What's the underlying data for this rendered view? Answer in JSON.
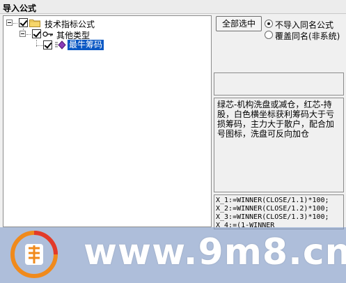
{
  "window": {
    "title": "导入公式"
  },
  "tree": {
    "root": {
      "label": "技术指标公式",
      "checked": true,
      "expanded": true
    },
    "group": {
      "label": "其他类型",
      "checked": true,
      "expanded": true
    },
    "item": {
      "label": "最牛筹码",
      "checked": true,
      "selected": true
    }
  },
  "actions": {
    "select_all": "全部选中",
    "options": [
      {
        "label": "不导入同名公式",
        "selected": true
      },
      {
        "label": "覆盖同名(非系统)",
        "selected": false
      }
    ]
  },
  "description": "绿芯-机构洗盘或减仓，红芯-持股，白色横坐标获利筹码大于亏损筹码，主力大于散户，配合加号图标，洗盘可反向加仓",
  "code_lines": [
    "X_1:=WINNER(CLOSE/1.1)*100;",
    "X_2:=WINNER(CLOSE/1.2)*100;",
    "X_3:=WINNER(CLOSE/1.3)*100;",
    "X_4:=(1-WINNER"
  ],
  "watermark": {
    "text": "www.9m8.cn",
    "logo_text": "9m8.cn"
  },
  "colors": {
    "selection": "#0a58c4",
    "watermark": "#7f9fcf",
    "logo_orange": "#f08a1c"
  }
}
